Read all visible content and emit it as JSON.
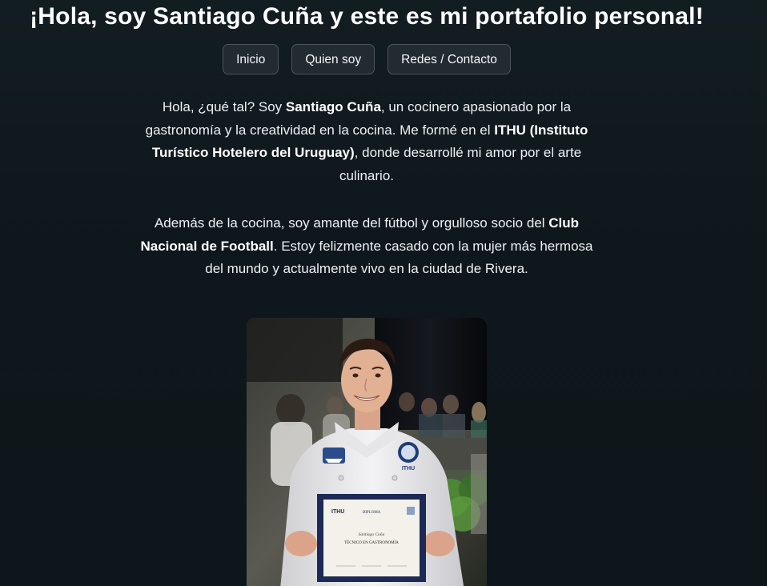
{
  "header": {
    "title": "¡Hola, soy Santiago Cuña y este es mi portafolio personal!"
  },
  "nav": {
    "items": [
      {
        "label": "Inicio"
      },
      {
        "label": "Quien soy"
      },
      {
        "label": "Redes / Contacto"
      }
    ]
  },
  "bio": {
    "p1": {
      "a": "Hola, ¿qué tal? Soy ",
      "b": "Santiago Cuña",
      "c": ", un cocinero apasionado por la gastronomía y la creatividad en la cocina. Me formé en el ",
      "d": "ITHU (Instituto Turístico Hotelero del Uruguay)",
      "e": ", donde desarrollé mi amor por el arte culinario."
    },
    "p2": {
      "a": "Además de la cocina, soy amante del fútbol y orgulloso socio del ",
      "b": "Club Nacional de Football",
      "c": ". Estoy felizmente casado con la mujer más hermosa del mundo y actualmente vivo en la ciudad de Rivera."
    }
  },
  "photo": {
    "diploma_header": "DIPLOMA",
    "diploma_logo": "ITHU",
    "diploma_name": "Santiago Cuña",
    "diploma_title": "TÉCNICO EN GASTRONOMÍA",
    "jacket_badge": "ITHU"
  }
}
